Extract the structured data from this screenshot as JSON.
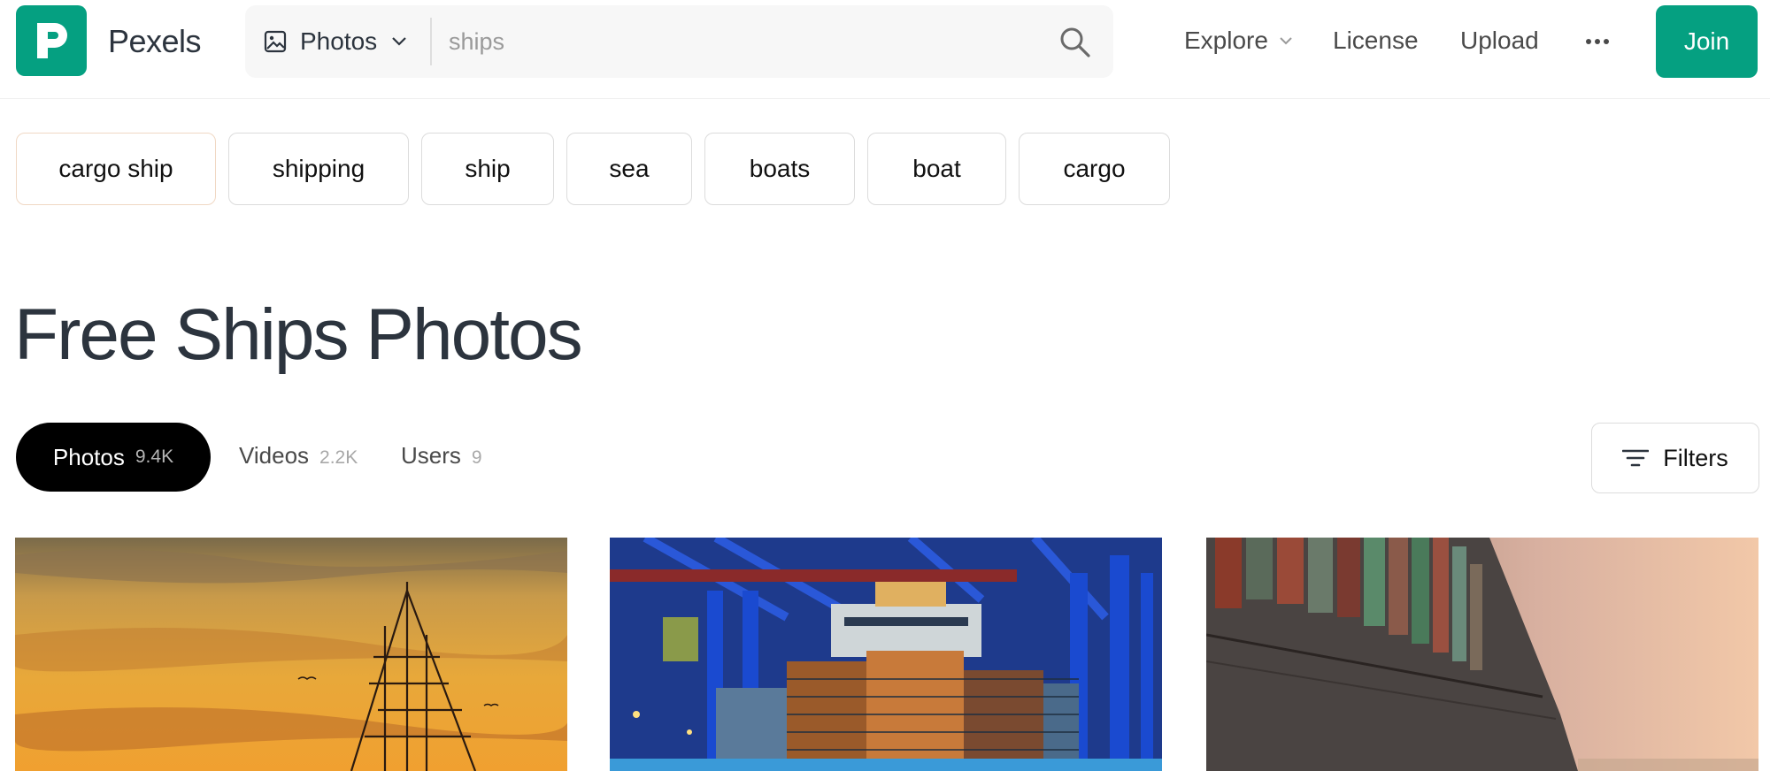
{
  "header": {
    "brand": "Pexels",
    "search": {
      "type_label": "Photos",
      "query": "ships",
      "placeholder": "ships"
    },
    "nav": {
      "explore": "Explore",
      "license": "License",
      "upload": "Upload",
      "join": "Join"
    }
  },
  "related_searches": [
    "cargo ship",
    "shipping",
    "ship",
    "sea",
    "boats",
    "boat",
    "cargo"
  ],
  "page_title": "Free Ships Photos",
  "tabs": {
    "photos": {
      "label": "Photos",
      "count": "9.4K"
    },
    "videos": {
      "label": "Videos",
      "count": "2.2K"
    },
    "users": {
      "label": "Users",
      "count": "9"
    }
  },
  "filters_label": "Filters",
  "colors": {
    "brand_green": "#05a081",
    "text_dark": "#2c343e",
    "active_tab": "#000000"
  },
  "icons": [
    "pexels-logo-icon",
    "image-icon",
    "chevron-down-icon",
    "search-icon",
    "more-icon",
    "filter-icon"
  ]
}
